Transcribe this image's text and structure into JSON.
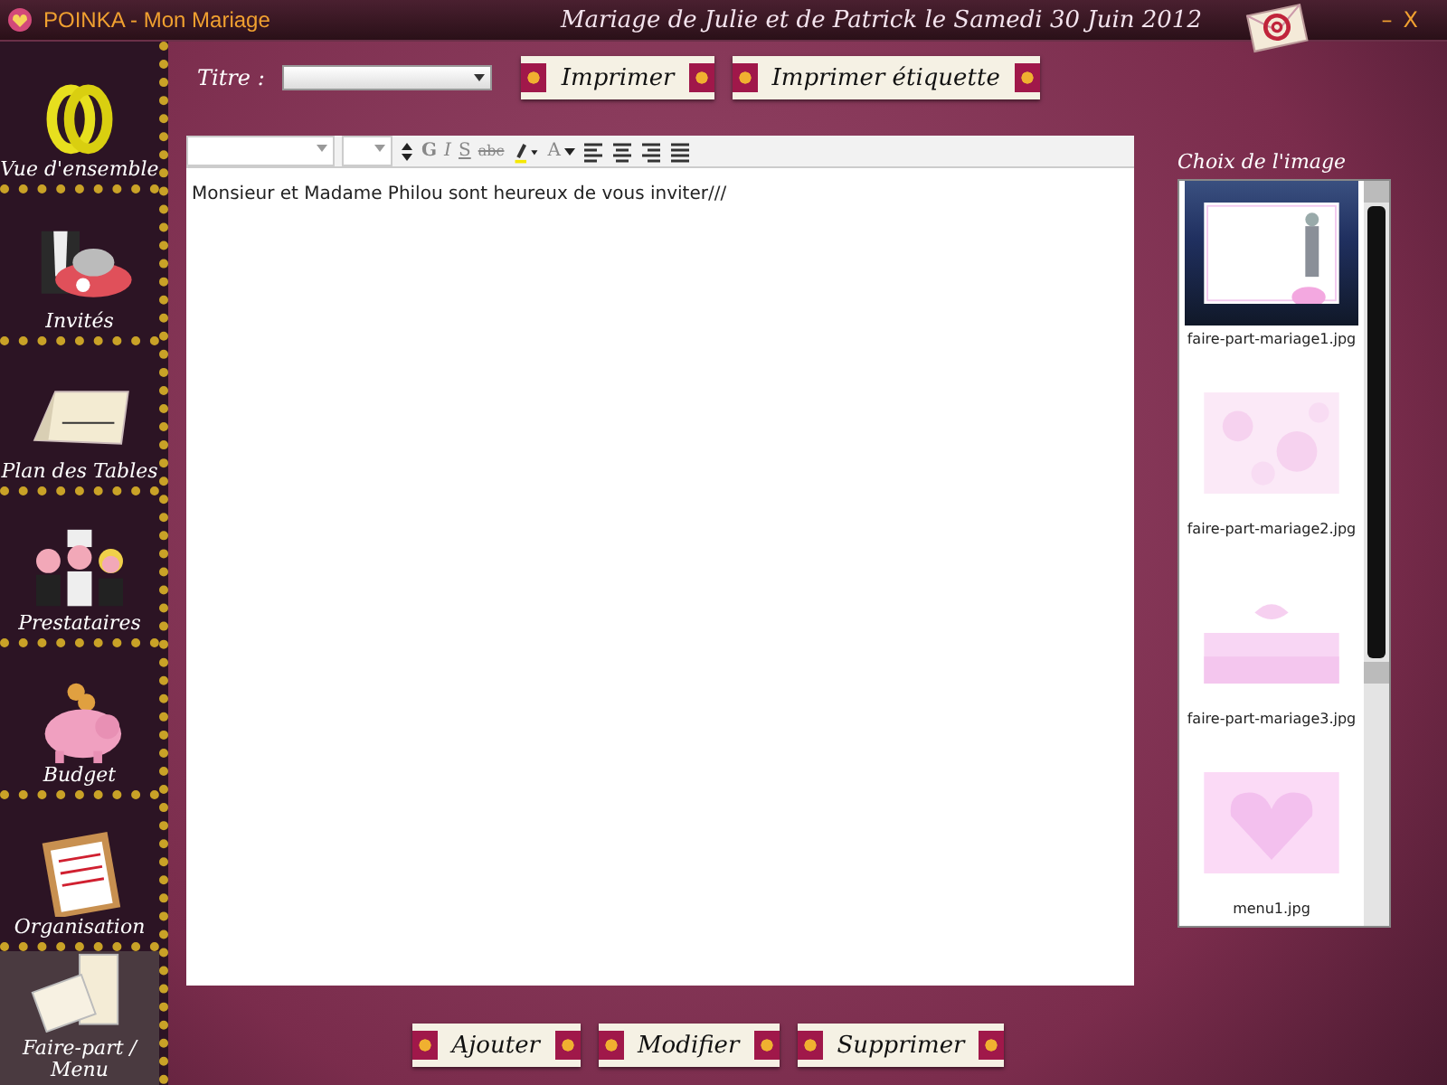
{
  "window": {
    "app_title": "POINKA - Mon Mariage",
    "title": "Mariage de Julie et de Patrick le Samedi 30 Juin 2012",
    "controls": [
      "–",
      "X"
    ]
  },
  "sidebar": {
    "items": [
      {
        "label": "Vue d'ensemble",
        "selected": false
      },
      {
        "label": "Invités",
        "selected": false
      },
      {
        "label": "Plan des Tables",
        "selected": false
      },
      {
        "label": "Prestataires",
        "selected": false
      },
      {
        "label": "Budget",
        "selected": false
      },
      {
        "label": "Organisation",
        "selected": false
      },
      {
        "label": "Faire-part / Menu",
        "selected": true
      }
    ]
  },
  "title_field": {
    "label": "Titre :"
  },
  "top_buttons": [
    "Imprimer",
    "Imprimer étiquette"
  ],
  "editor": {
    "toolbar": [
      {
        "kind": "select"
      },
      {
        "kind": "select-small"
      },
      {
        "kind": "spinner"
      },
      {
        "kind": "bold",
        "text": "G"
      },
      {
        "kind": "italic",
        "text": "I"
      },
      {
        "kind": "underline",
        "text": "S"
      },
      {
        "kind": "strike",
        "text": "abc"
      },
      {
        "kind": "highlight"
      },
      {
        "kind": "color",
        "text": "A"
      },
      {
        "kind": "left"
      },
      {
        "kind": "center"
      },
      {
        "kind": "right"
      },
      {
        "kind": "justify"
      }
    ],
    "text": "Monsieur et Madame Philou sont heureux de vous inviter///"
  },
  "image_panel": {
    "title": "Choix de l'image",
    "images": [
      {
        "name": "faire-part-mariage1.jpg",
        "selected": true,
        "kind": "couple"
      },
      {
        "name": "faire-part-mariage2.jpg",
        "selected": false,
        "kind": "pattern"
      },
      {
        "name": "faire-part-mariage3.jpg",
        "selected": false,
        "kind": "gradient"
      },
      {
        "name": "menu1.jpg",
        "selected": false,
        "kind": "heart"
      }
    ]
  },
  "bottom_buttons": [
    "Ajouter",
    "Modifier",
    "Supprimer"
  ]
}
